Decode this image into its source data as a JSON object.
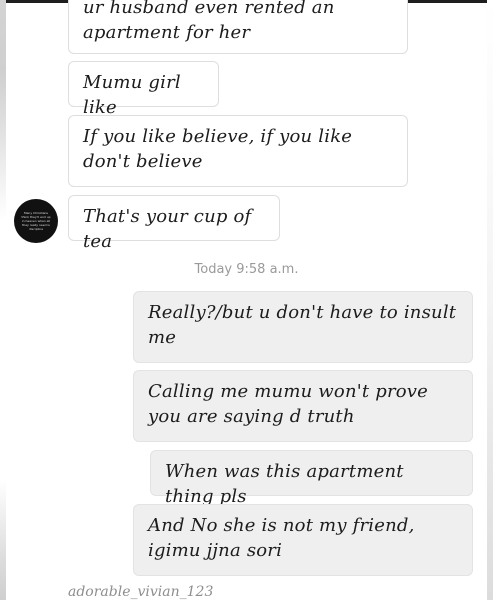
{
  "thread": {
    "received": [
      {
        "text": "ur husband even rented an apartment for her"
      },
      {
        "text": "Mumu girl like"
      },
      {
        "text": "If you like believe, if you like don't believe"
      },
      {
        "text": "That's your cup of tea"
      }
    ],
    "avatar_caption": "Many Christians think they'll end up in heaven when all they really need is discipline",
    "timestamp": "Today 9:58 a.m.",
    "sent": [
      {
        "text": "Really?/but u don't have to insult me"
      },
      {
        "text": "Calling me mumu won't prove you are saying d truth"
      },
      {
        "text": "When was this apartment thing pls"
      },
      {
        "text": "And No she is not my friend, igimu jjna sori"
      }
    ],
    "watermark": "adorable_vivian_123"
  },
  "colors": {
    "sent_bubble": "#efefef",
    "received_bubble": "#ffffff",
    "bubble_border": "#dedede",
    "timestamp": "#9a9a9a"
  }
}
